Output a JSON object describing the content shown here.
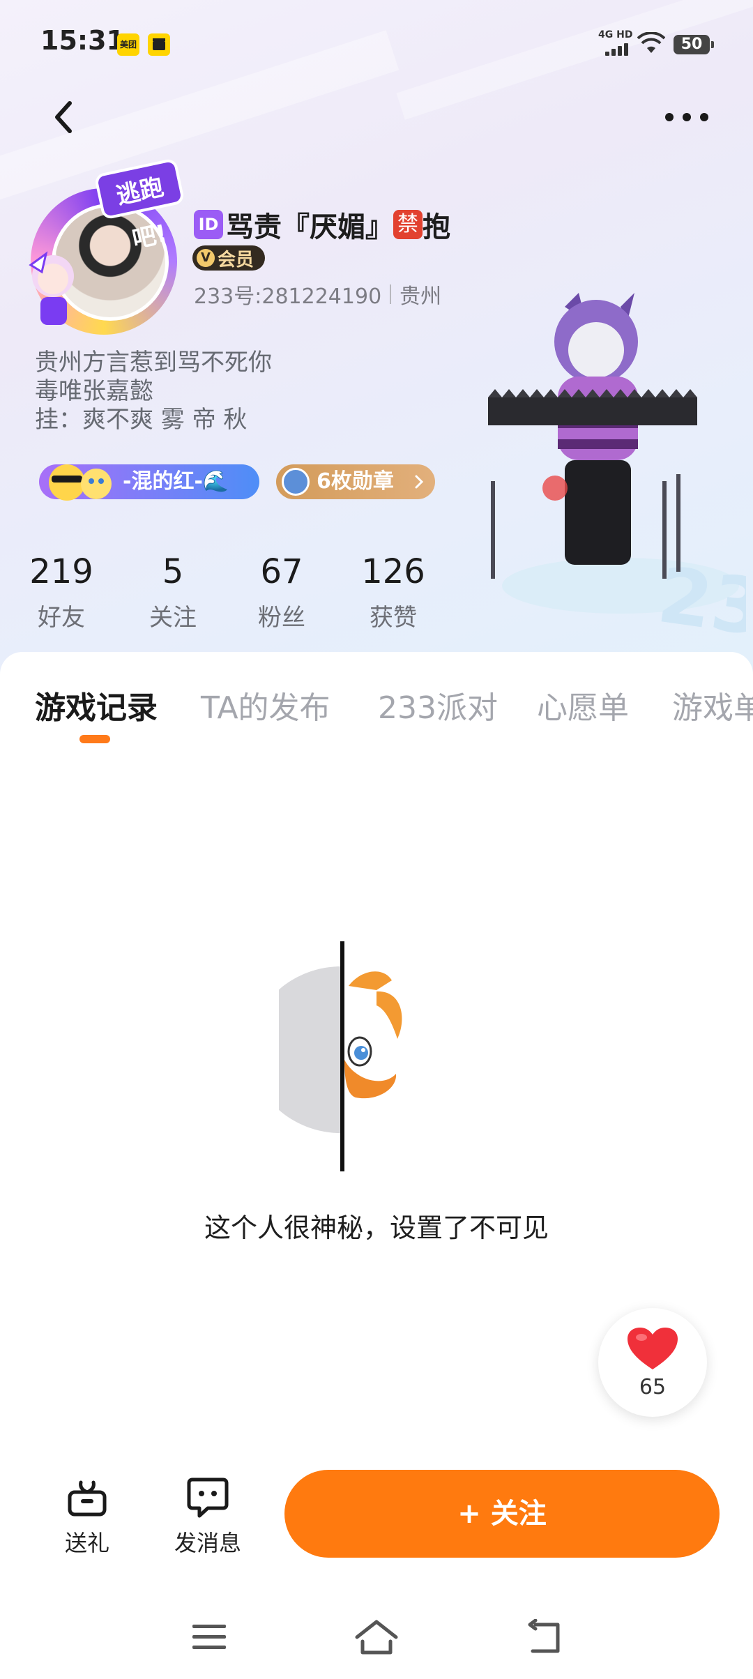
{
  "status_bar": {
    "time": "15:31",
    "app_icon_1": "美团",
    "network": "4G HD",
    "battery": "50"
  },
  "profile": {
    "id_tag": "ID",
    "name": "骂责『厌媚』",
    "ban_tag": "禁",
    "name_suffix": "抱",
    "vip": "会员",
    "uid": "233号:281224190",
    "location": "贵州",
    "avatar_badge": "逃跑吧!",
    "bio": [
      "贵州方言惹到骂不死你",
      "毒唯张嘉懿",
      "挂：爽不爽 雾 帝 秋"
    ]
  },
  "tags": {
    "group": "-混的红-🌊",
    "medals": "6枚勋章"
  },
  "stats": [
    {
      "value": "219",
      "label": "好友"
    },
    {
      "value": "5",
      "label": "关注"
    },
    {
      "value": "67",
      "label": "粉丝"
    },
    {
      "value": "126",
      "label": "获赞"
    }
  ],
  "tabs": [
    "游戏记录",
    "TA的发布",
    "233派对",
    "心愿单",
    "游戏单"
  ],
  "active_tab": "游戏记录",
  "empty_state": {
    "message": "这个人很神秘，设置了不可见"
  },
  "like": {
    "count": "65"
  },
  "actions": {
    "gift": "送礼",
    "message": "发消息",
    "follow": "+ 关注"
  },
  "colors": {
    "accent": "#ff7a0f",
    "vip": "#332a20",
    "id_tag": "#9b5cf5",
    "ban_tag": "#e2412f"
  }
}
